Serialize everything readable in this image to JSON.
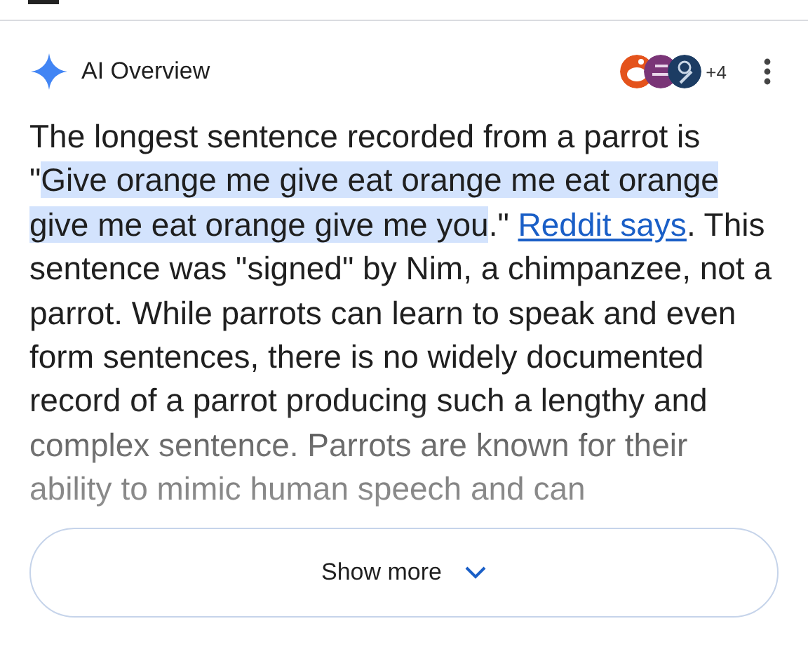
{
  "header": {
    "title": "AI Overview",
    "more_sources": "+4"
  },
  "answer": {
    "lead": "The longest sentence recorded from a parrot is \"",
    "quote": "Give orange me give eat orange me eat orange give me eat orange give me you",
    "after_quote": ".\" ",
    "link": "Reddit says",
    "rest": ". This sentence was \"signed\" by Nim, a chimpanzee, not a parrot. While parrots can learn to speak and even form sentences, there is no widely documented record of a parrot producing such a lengthy and complex sentence. Parrots are known for their ability to mimic human speech and can"
  },
  "show_more": {
    "label": "Show more"
  }
}
